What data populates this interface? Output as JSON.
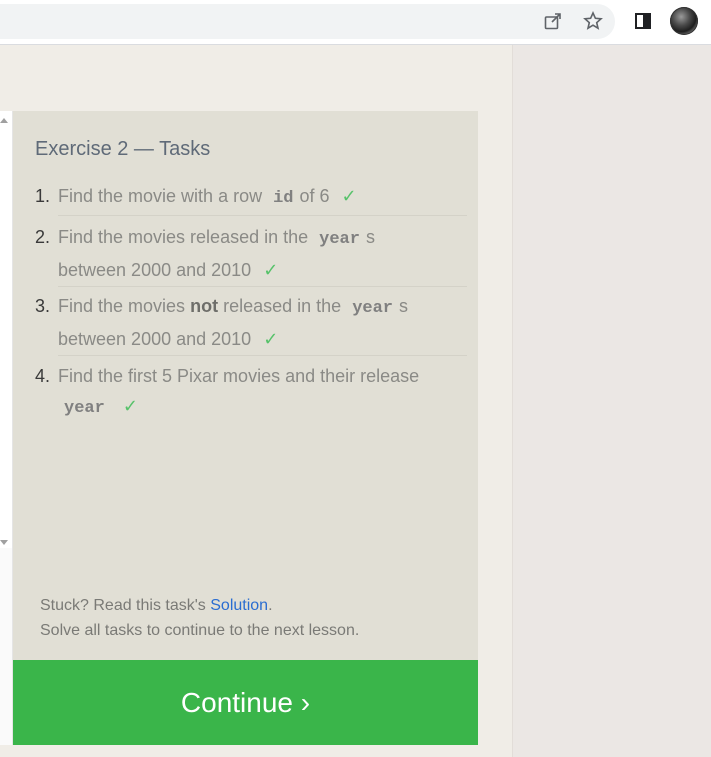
{
  "browser": {
    "icons": [
      "share-icon",
      "star-icon",
      "side-panel-icon",
      "profile-avatar"
    ]
  },
  "panel": {
    "title": "Exercise 2 — Tasks",
    "tasks": [
      {
        "num": "1.",
        "pre": "Find the movie with a row",
        "code": "id",
        "post": "of 6",
        "check": "✓"
      },
      {
        "num": "2.",
        "pre": "Find the movies released in the",
        "code": "year",
        "post": "s",
        "line2": "between 2000 and 2010",
        "check": "✓"
      },
      {
        "num": "3.",
        "pre": "Find the movies",
        "strong": "not",
        "mid": "released in the",
        "code": "year",
        "post": "s",
        "line2": "between 2000 and 2010",
        "check": "✓"
      },
      {
        "num": "4.",
        "pre": "Find the first 5 Pixar movies and their release",
        "code": "year",
        "check": "✓"
      }
    ],
    "stuck_prefix": "Stuck? Read this task's",
    "solution_link": "Solution",
    "stuck_suffix": ".",
    "next_text": "Solve all tasks to continue to the next lesson."
  },
  "continue_label": "Continue ›",
  "colors": {
    "panel_bg": "#e1dfd5",
    "continue_bg": "#3ab54a",
    "check": "#57c26a",
    "link": "#2a6dd1"
  }
}
